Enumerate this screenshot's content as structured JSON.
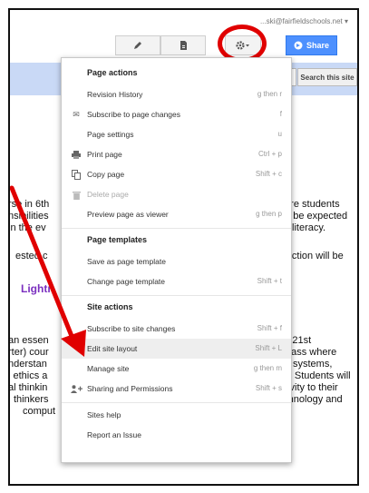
{
  "header": {
    "account_email": "...ski@fairfieldschools.net ▾",
    "share_label": "Share",
    "search_button_label": "Search this site"
  },
  "background_text": {
    "left_lines": [
      "rse in 6th",
      "nsibilities",
      "in the ev",
      "ested c",
      "an essen",
      "rter) cour",
      "nderstan",
      "l ethics a",
      "al thinkin",
      "thinkers",
      "comput"
    ],
    "right_lines": [
      "where students",
      "also be expected",
      "uter literacy.",
      "instruction will be",
      "the 21st",
      "d class where",
      "systems,",
      "ty. Students will",
      "tivity to their",
      "technology and"
    ],
    "purple_heading": "Lightn"
  },
  "menu": {
    "sections": [
      {
        "header": "Page actions",
        "items": [
          {
            "label": "Revision History",
            "shortcut": "g then r",
            "icon": ""
          },
          {
            "label": "Subscribe to page changes",
            "shortcut": "f",
            "icon": "envelope-icon"
          },
          {
            "label": "Page settings",
            "shortcut": "u",
            "icon": ""
          },
          {
            "label": "Print page",
            "shortcut": "Ctrl + p",
            "icon": "printer-icon"
          },
          {
            "label": "Copy page",
            "shortcut": "Shift + c",
            "icon": "copy-icon"
          },
          {
            "label": "Delete page",
            "shortcut": "",
            "icon": "trash-icon",
            "disabled": true
          },
          {
            "label": "Preview page as viewer",
            "shortcut": "g then p",
            "icon": ""
          }
        ]
      },
      {
        "header": "Page templates",
        "items": [
          {
            "label": "Save as page template",
            "shortcut": "",
            "icon": ""
          },
          {
            "label": "Change page template",
            "shortcut": "Shift + t",
            "icon": ""
          }
        ]
      },
      {
        "header": "Site actions",
        "items": [
          {
            "label": "Subscribe to site changes",
            "shortcut": "Shift + f",
            "icon": ""
          },
          {
            "label": "Edit site layout",
            "shortcut": "Shift + L",
            "icon": "",
            "highlighted": true
          },
          {
            "label": "Manage site",
            "shortcut": "g then m",
            "icon": ""
          },
          {
            "label": "Sharing and Permissions",
            "shortcut": "Shift + s",
            "icon": "add-person-icon"
          }
        ]
      },
      {
        "header": "",
        "items": [
          {
            "label": "Sites help",
            "shortcut": "",
            "icon": ""
          },
          {
            "label": "Report an Issue",
            "shortcut": "",
            "icon": ""
          }
        ]
      }
    ]
  },
  "colors": {
    "accent_blue": "#4d90fe",
    "band_blue": "#c9d9f6",
    "annotation_red": "#e00000",
    "purple_heading": "#7b2fbf"
  }
}
